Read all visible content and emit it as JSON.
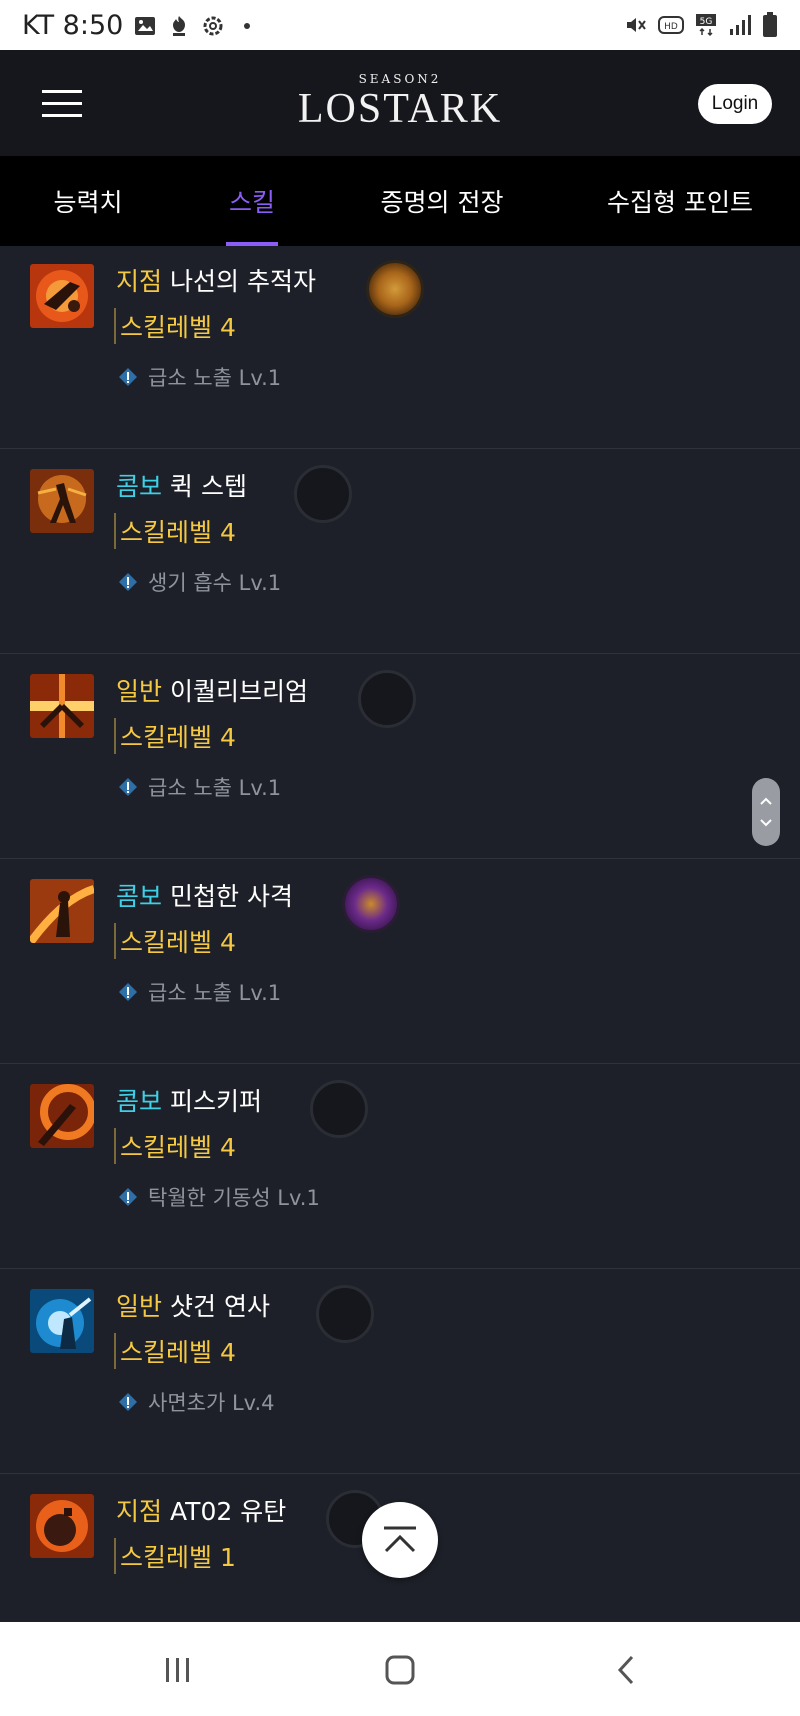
{
  "status_bar": {
    "carrier_time": "KT 8:50",
    "icons_left": [
      "gallery-icon",
      "app-icon",
      "settings-icon",
      "dot-icon"
    ],
    "icons_right": [
      "mute-icon",
      "hd-icon",
      "5g-icon",
      "signal-icon",
      "battery-icon"
    ]
  },
  "header": {
    "logo_season": "SEASON2",
    "logo_name": "LOSTARK",
    "login_label": "Login"
  },
  "tabs": [
    {
      "label": "능력치",
      "active": false
    },
    {
      "label": "스킬",
      "active": true
    },
    {
      "label": "증명의 전장",
      "active": false
    },
    {
      "label": "수집형 포인트",
      "active": false
    }
  ],
  "skills": [
    {
      "type": "지점",
      "type_color": "#f5c842",
      "name": "나선의 추적자",
      "level_text": "스킬레벨 4",
      "tripod": "급소 노출 Lv.1",
      "gem": "orange"
    },
    {
      "type": "콤보",
      "type_color": "#3fd0e6",
      "name": "퀵 스텝",
      "level_text": "스킬레벨 4",
      "tripod": "생기 흡수 Lv.1",
      "gem": "empty"
    },
    {
      "type": "일반",
      "type_color": "#f5c842",
      "name": "이퀄리브리엄",
      "level_text": "스킬레벨 4",
      "tripod": "급소 노출 Lv.1",
      "gem": "empty"
    },
    {
      "type": "콤보",
      "type_color": "#3fd0e6",
      "name": "민첩한 사격",
      "level_text": "스킬레벨 4",
      "tripod": "급소 노출 Lv.1",
      "gem": "purple"
    },
    {
      "type": "콤보",
      "type_color": "#3fd0e6",
      "name": "피스키퍼",
      "level_text": "스킬레벨 4",
      "tripod": "탁월한 기동성 Lv.1",
      "gem": "empty"
    },
    {
      "type": "일반",
      "type_color": "#f5c842",
      "name": "샷건 연사",
      "level_text": "스킬레벨 4",
      "tripod": "사면초가 Lv.4",
      "gem": "empty"
    },
    {
      "type": "지점",
      "type_color": "#f5c842",
      "name": "AT02 유탄",
      "level_text": "스킬레벨 1",
      "tripod": "",
      "gem": "empty"
    }
  ],
  "colors": {
    "accent": "#8c5cf6",
    "skill_level": "#f5c842",
    "tripod_text": "#8f939c",
    "background": "#1d2028"
  }
}
